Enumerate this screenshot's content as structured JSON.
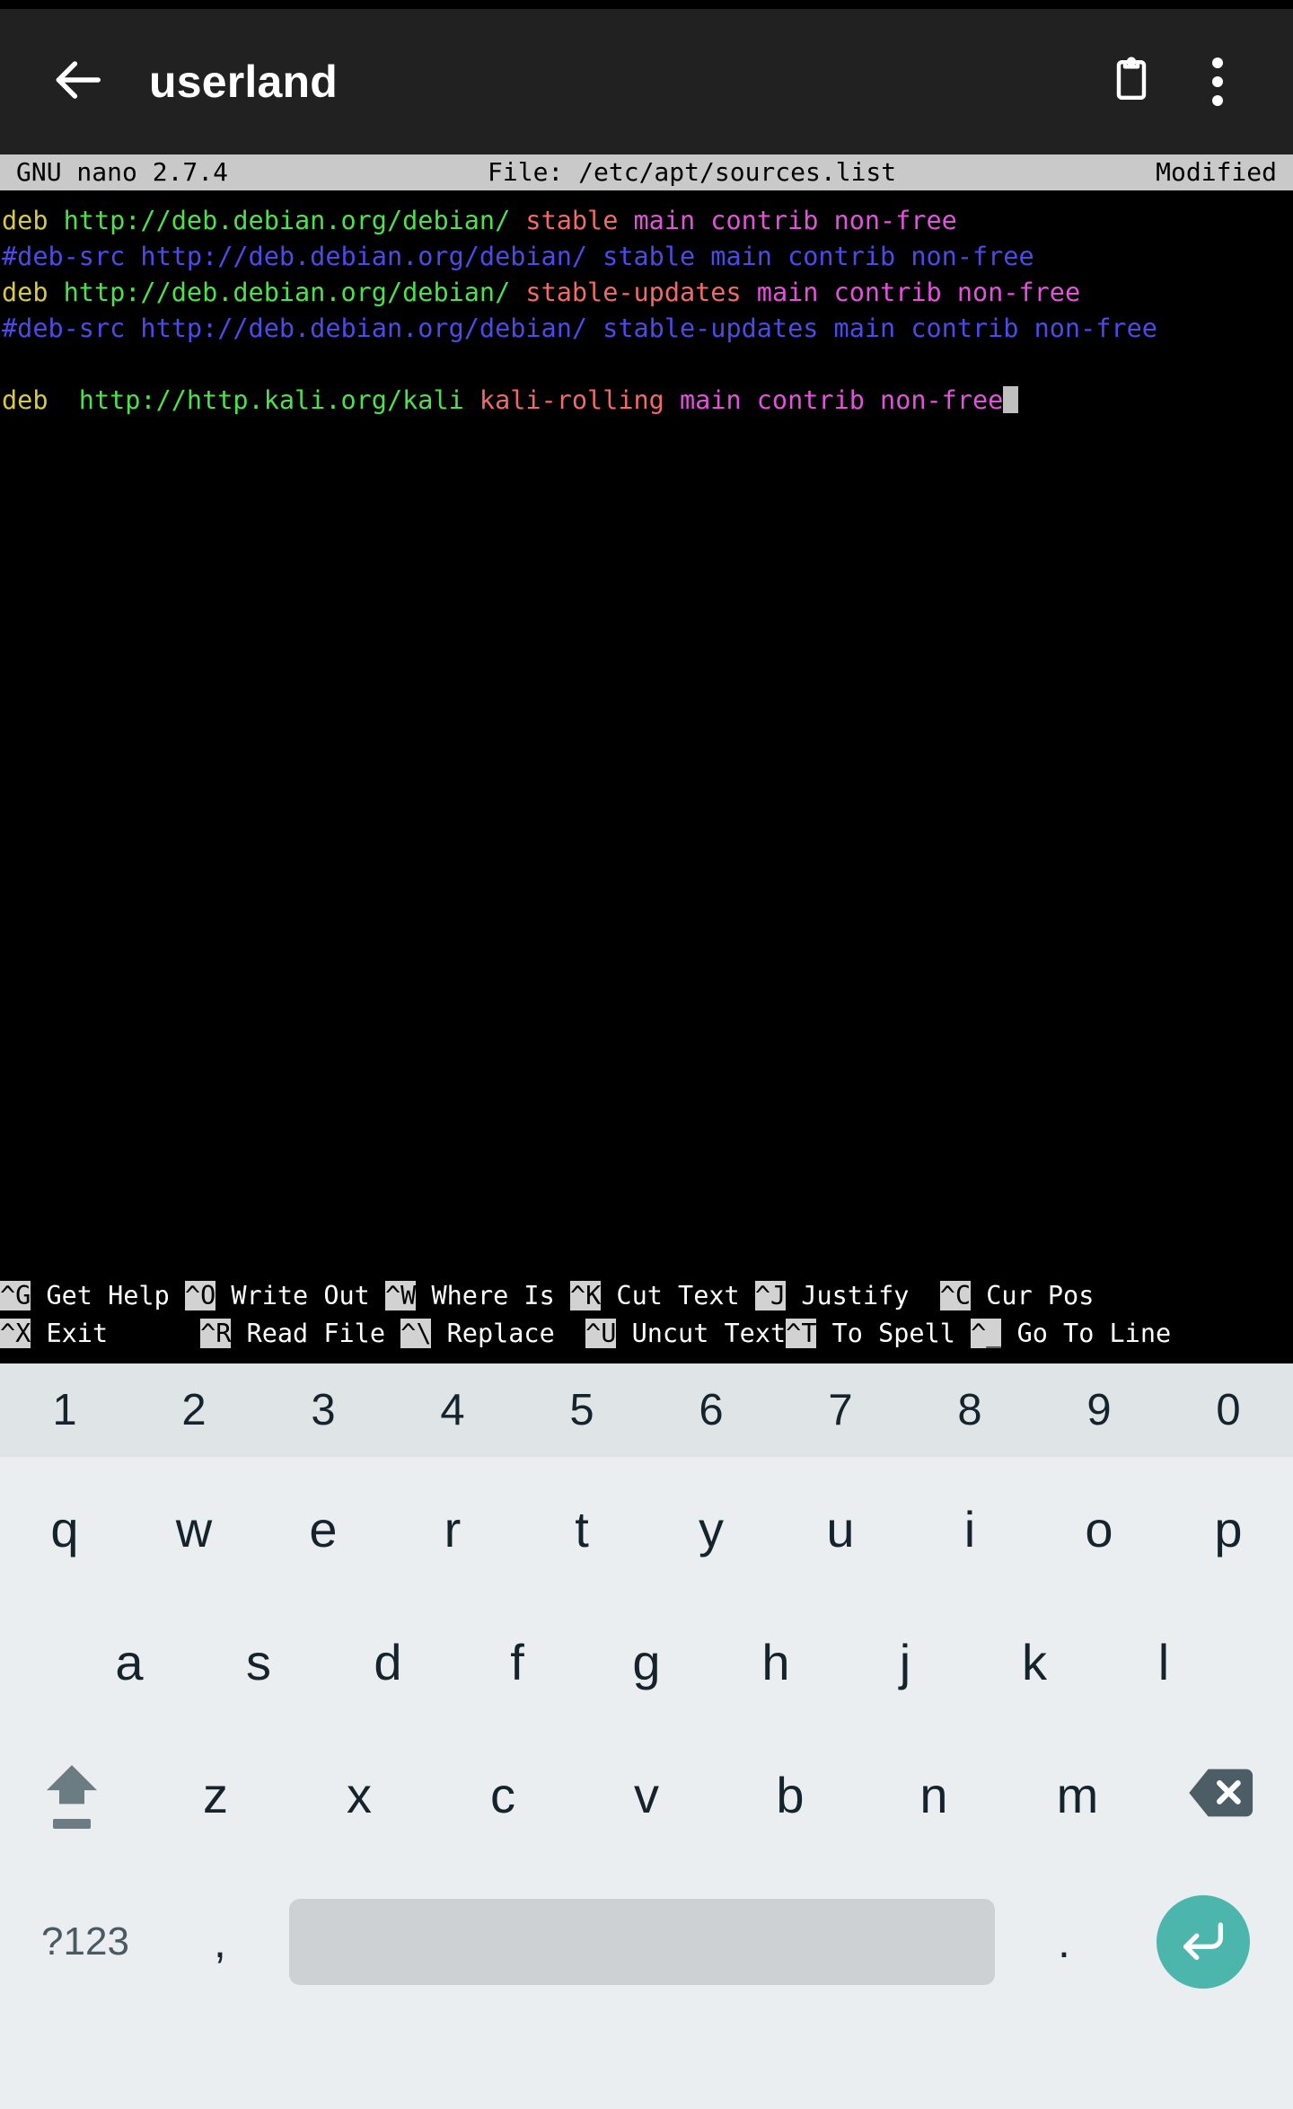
{
  "app_bar": {
    "title": "userland",
    "back_icon": "arrow-left-icon",
    "clipboard_icon": "clipboard-icon",
    "overflow_icon": "more-vertical-icon"
  },
  "nano": {
    "version_label": "GNU nano 2.7.4",
    "file_label": "File: /etc/apt/sources.list",
    "modified_label": "Modified",
    "lines": [
      {
        "segments": [
          {
            "text": "deb ",
            "cls": "c-kw"
          },
          {
            "text": "http://deb.debian.org/debian/ ",
            "cls": "c-url"
          },
          {
            "text": "stable ",
            "cls": "c-dist"
          },
          {
            "text": "main contrib non-free",
            "cls": "c-comp"
          }
        ]
      },
      {
        "segments": [
          {
            "text": "#deb-src http://deb.debian.org/debian/ stable main contrib non-free",
            "cls": "c-cmt"
          }
        ]
      },
      {
        "segments": [
          {
            "text": "deb ",
            "cls": "c-kw"
          },
          {
            "text": "http://deb.debian.org/debian/ ",
            "cls": "c-url"
          },
          {
            "text": "stable-updates ",
            "cls": "c-dist"
          },
          {
            "text": "main contrib non-free",
            "cls": "c-comp"
          }
        ]
      },
      {
        "segments": [
          {
            "text": "#deb-src http://deb.debian.org/debian/ stable-updates main contrib non-free",
            "cls": "c-cmt"
          }
        ]
      },
      {
        "blank": true
      },
      {
        "segments": [
          {
            "text": "deb  ",
            "cls": "c-kw"
          },
          {
            "text": "http://http.kali.org/kali ",
            "cls": "c-url"
          },
          {
            "text": "kali-rolling ",
            "cls": "c-dist"
          },
          {
            "text": "main contrib non-free",
            "cls": "c-comp"
          }
        ],
        "cursor": true
      }
    ],
    "help_row_1": [
      {
        "key": "^G",
        "label": " Get Help "
      },
      {
        "key": "^O",
        "label": " Write Out "
      },
      {
        "key": "^W",
        "label": " Where Is "
      },
      {
        "key": "^K",
        "label": " Cut Text "
      },
      {
        "key": "^J",
        "label": " Justify  "
      },
      {
        "key": "^C",
        "label": " Cur Pos"
      }
    ],
    "help_row_2": [
      {
        "key": "^X",
        "label": " Exit      "
      },
      {
        "key": "^R",
        "label": " Read File "
      },
      {
        "key": "^\\",
        "label": " Replace  "
      },
      {
        "key": "^U",
        "label": " Uncut Text"
      },
      {
        "key": "^T",
        "label": " To Spell "
      },
      {
        "key": "^_",
        "label": " Go To Line"
      }
    ]
  },
  "keyboard": {
    "number_row": [
      "1",
      "2",
      "3",
      "4",
      "5",
      "6",
      "7",
      "8",
      "9",
      "0"
    ],
    "row_q": [
      "q",
      "w",
      "e",
      "r",
      "t",
      "y",
      "u",
      "i",
      "o",
      "p"
    ],
    "row_a": [
      "a",
      "s",
      "d",
      "f",
      "g",
      "h",
      "j",
      "k",
      "l"
    ],
    "row_z": [
      "z",
      "x",
      "c",
      "v",
      "b",
      "n",
      "m"
    ],
    "shift_icon": "shift-icon",
    "backspace_icon": "backspace-icon",
    "symbols_key": "?123",
    "comma_key": ",",
    "period_key": ".",
    "space_key": "",
    "enter_icon": "enter-icon",
    "enter_color": "#4db6ac"
  },
  "colors": {
    "app_bar_bg": "#212121",
    "terminal_bg": "#000000",
    "nano_titlebar_bg": "#c9c9c9",
    "keyboard_bg": "#eaeef0",
    "number_row_bg": "#dfe4e7",
    "key_text": "#15242c",
    "spacebar": "#cdd1d3",
    "keyword": "#d7c94c",
    "url": "#4fe04f",
    "dist": "#f06a6a",
    "components": "#e055d8",
    "comment": "#4b4be8"
  }
}
